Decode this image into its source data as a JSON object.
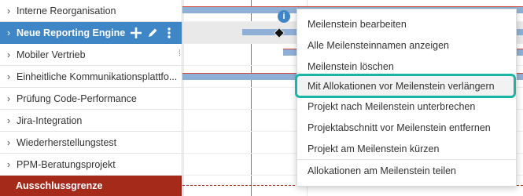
{
  "projects": [
    {
      "label": "Interne Reorganisation",
      "expand_icon": "chevron-right-icon",
      "selected": false
    },
    {
      "label": "Neue Reporting Engine",
      "expand_icon": "chevron-right-icon",
      "selected": true,
      "actions": [
        {
          "name": "add-icon",
          "glyph": "plus"
        },
        {
          "name": "edit-icon",
          "glyph": "pencil"
        },
        {
          "name": "more-icon",
          "glyph": "vertical-dots"
        }
      ]
    },
    {
      "label": "Mobiler Vertrieb",
      "expand_icon": "chevron-right-icon",
      "selected": false
    },
    {
      "label": "Einheitliche Kommunikationsplattfo...",
      "expand_icon": "chevron-right-icon",
      "selected": false
    },
    {
      "label": "Prüfung Code-Performance",
      "expand_icon": "chevron-right-icon",
      "selected": false
    },
    {
      "label": "Jira-Integration",
      "expand_icon": "chevron-right-icon",
      "selected": false
    },
    {
      "label": "Wiederherstellungstest",
      "expand_icon": "chevron-right-icon",
      "selected": false
    },
    {
      "label": "PPM-Beratungsprojekt",
      "expand_icon": "chevron-right-icon",
      "selected": false
    }
  ],
  "cutoff": {
    "label": "Ausschlussgrenze"
  },
  "milestone_handle": {
    "glyph": "i"
  },
  "context_menu": {
    "items": [
      {
        "label": "Meilenstein bearbeiten",
        "highlight": false
      },
      {
        "label": "Alle Meilensteinnamen anzeigen",
        "highlight": false
      },
      {
        "label": "Meilenstein löschen",
        "highlight": false
      },
      {
        "label": "Mit Allokationen vor Meilenstein verlängern",
        "highlight": true
      },
      {
        "label": "Projekt nach Meilenstein unterbrechen",
        "highlight": false
      },
      {
        "label": "Projektabschnitt vor Meilenstein entfernen",
        "highlight": false
      },
      {
        "label": "Projekt am Meilenstein kürzen",
        "highlight": false
      },
      {
        "label": "Allokationen am Meilenstein teilen",
        "highlight": false
      }
    ]
  },
  "colors": {
    "selected_row": "#3f86c6",
    "cutoff_row": "#a52a1a",
    "bar": "#8fb0d6",
    "today_line": "#d9534f",
    "highlight_border": "#19b6a8"
  }
}
